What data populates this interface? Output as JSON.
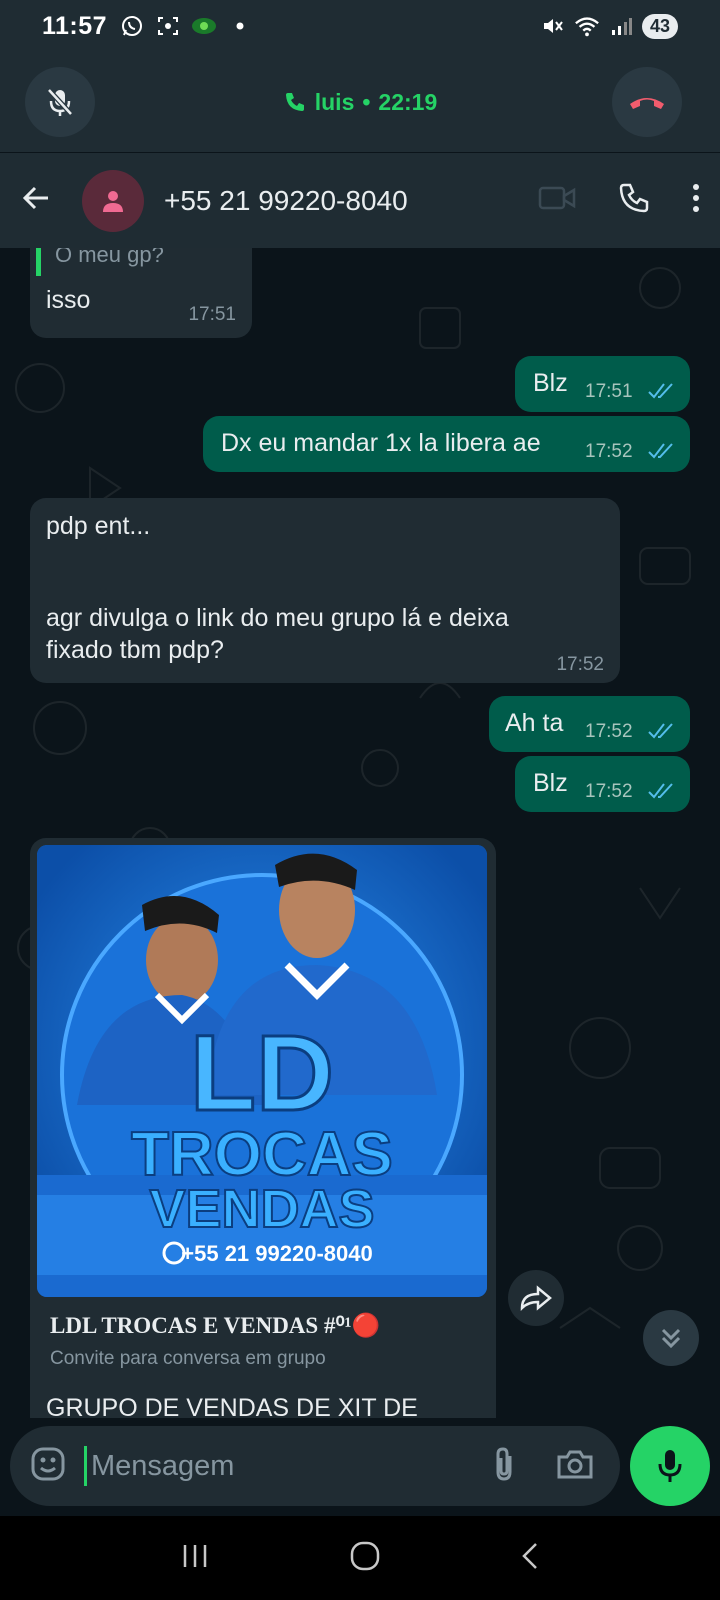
{
  "status_bar": {
    "time": "11:57",
    "battery": "43"
  },
  "call": {
    "caller": "luis",
    "separator": "•",
    "duration": "22:19"
  },
  "header": {
    "contact": "+55 21 99220-8040"
  },
  "messages": [
    {
      "dir": "in",
      "quote": "O meu gp?",
      "text": "isso",
      "time": "17:51"
    },
    {
      "dir": "out",
      "text": "Blz",
      "time": "17:51"
    },
    {
      "dir": "out",
      "text": "Dx eu mandar 1x la libera ae",
      "time": "17:52"
    },
    {
      "dir": "in",
      "lines": [
        "pdp ent...",
        "",
        "agr divulga o link do meu grupo lá e deixa",
        "fixado tbm pdp?"
      ],
      "time": "17:52"
    },
    {
      "dir": "out",
      "text": "Ah ta",
      "time": "17:52"
    },
    {
      "dir": "out",
      "text": "Blz",
      "time": "17:52"
    }
  ],
  "invite": {
    "image_big": "LD",
    "image_line2": "TROCAS",
    "image_line3": "VENDAS",
    "image_phone": "+55 21 99220-8040",
    "title": "LDL TROCAS E VENDAS #⁰¹🔴",
    "subtitle": "Convite para conversa em grupo",
    "description": "GRUPO DE VENDAS DE XIT DE"
  },
  "input": {
    "placeholder": "Mensagem"
  },
  "colors": {
    "accent": "#25d366",
    "outgoing": "#005c4b",
    "incoming": "#202c33",
    "end_call": "#f15c6d",
    "read_ticks": "#53bdeb"
  }
}
